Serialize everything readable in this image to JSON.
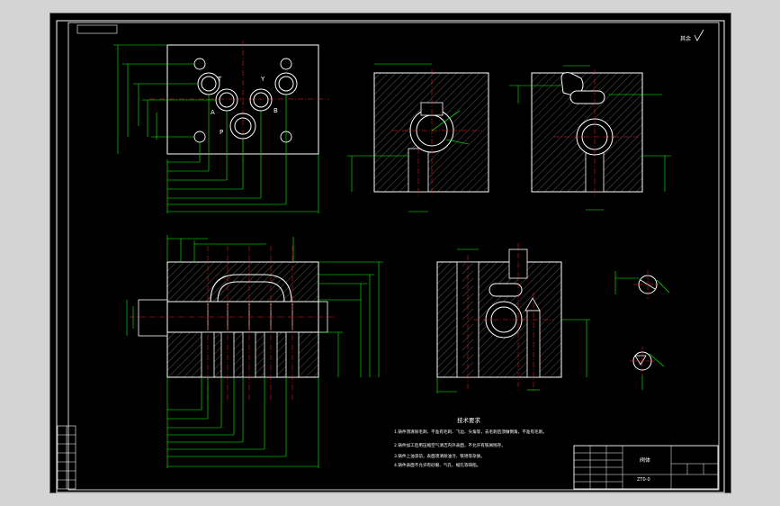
{
  "colors": {
    "background": "#000000",
    "frame": "#ffffff",
    "dimension": "#00ff00",
    "centerline": "#ff2020",
    "hatch": "#707070",
    "annotation": "#ffffff",
    "chrome": "#d4d4d4"
  },
  "top_view": {
    "port_labels": [
      "T",
      "Y",
      "A",
      "B",
      "P"
    ]
  },
  "technical_requirements": {
    "title": "技术要求",
    "items": [
      "1.铸件须清除毛刺、不准有毛刺、飞边、尖角等，去毛刺后须做倒角，不准有毛刺。",
      "2.铸件加工后用压缩空气清洁内外表面，不允许有铁屑残存。",
      "3.铸件上油漆前，表面须清除油污、铁锈等杂质。",
      "4.铸件表面不允许有砂眼、气孔、缩孔等缺陷。"
    ]
  },
  "title_block": {
    "part_name": "阀体",
    "drawing_code": "ZT0-0"
  },
  "roughness_note": "其余"
}
